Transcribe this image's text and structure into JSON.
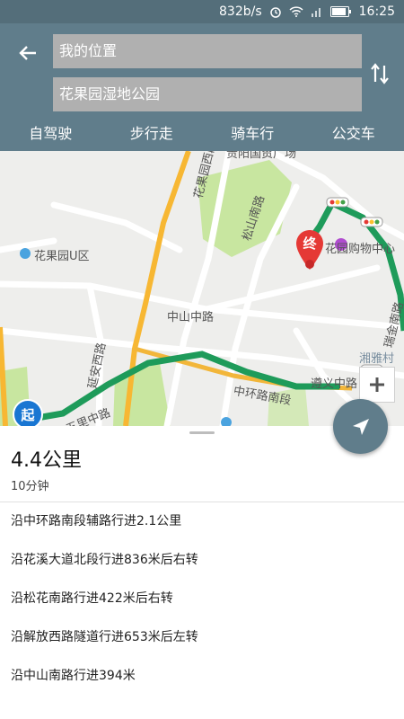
{
  "status_bar": {
    "net_speed": "832b/s",
    "time": "16:25"
  },
  "header": {
    "start_value": "我的位置",
    "end_value": "花果园湿地公园",
    "modes": [
      "自驾驶",
      "步行走",
      "骑车行",
      "公交车"
    ]
  },
  "map": {
    "labels": [
      "花果园U区",
      "松山南路",
      "中山中路",
      "延安西路",
      "中环路南段",
      "遵义中路",
      "湘雅村",
      "五里中路",
      "瑞金南路",
      "花果园西段",
      "花园购物中心",
      "贵阳国贸广场"
    ],
    "start_marker": "起",
    "end_marker": "终"
  },
  "route": {
    "distance": "4.4公里",
    "duration": "10分钟",
    "steps": [
      "沿中环路南段辅路行进2.1公里",
      "沿花溪大道北段行进836米后右转",
      "沿松花南路行进422米后右转",
      "沿解放西路隧道行进653米后左转",
      "沿中山南路行进394米"
    ]
  },
  "colors": {
    "header": "#607d8b",
    "status_bar": "#546e7a",
    "field": "#b0b0b0",
    "route_green": "#1e9b5a",
    "marker_red": "#e53935",
    "start_blue": "#1976d2"
  }
}
